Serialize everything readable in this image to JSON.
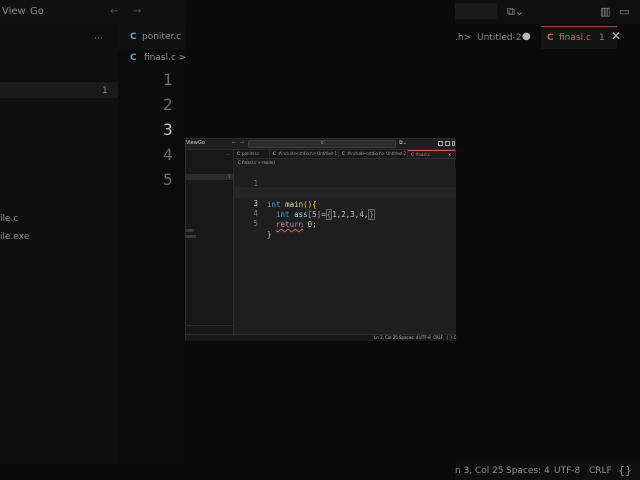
{
  "background": {
    "menu": [
      "View",
      "Go"
    ],
    "tab_left": "poniter.c",
    "tab_right_title": "Untitled-2",
    "tab_right_active": "finasl.c",
    "breadcrumb": "finasl.c >",
    "line_numbers": [
      "1",
      "2",
      "3",
      "4",
      "5"
    ],
    "sidebar_files": [
      "ile.c",
      "ile.exe"
    ],
    "status": [
      "n 3, Col 25",
      "Spaces: 4",
      "UTF-8",
      "CRLF"
    ],
    "h_suffix": ".h>"
  },
  "window": {
    "menu": [
      "View",
      "Go"
    ],
    "search_glyph": "c",
    "tabs": [
      {
        "label": "poniter.c"
      },
      {
        "label": "#include<stdio.h> Untitled-1"
      },
      {
        "label": "#include<stdio.h> Untitled-2"
      },
      {
        "label": "finasl.c"
      }
    ],
    "breadcrumb": "C finasl.c > main()",
    "code": [
      {
        "n": "1"
      },
      {
        "n": "2"
      },
      {
        "n": "3"
      },
      {
        "n": "4"
      },
      {
        "n": "5"
      }
    ],
    "status": {
      "position": "Ln 3, Col 25",
      "spaces": "Spaces: 4",
      "encoding": "UTF-8",
      "eol": "CRLF",
      "lang": "{ } C"
    }
  },
  "colors": {
    "keyword": "#569cd6",
    "preprocessor": "#c586c0",
    "function": "#dcdcaa",
    "number": "#b5cea8",
    "active_tab_accent": "#e05a5a"
  }
}
